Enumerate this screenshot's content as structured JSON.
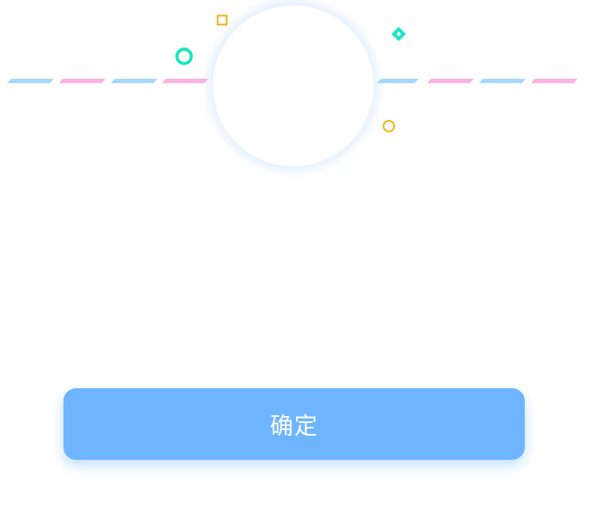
{
  "colors": {
    "blue_stripe": "#a6d8ff",
    "pink_stripe": "#ffb3e0",
    "teal": "#14e8c0",
    "yellow": "#f2b51d",
    "button": "#6fb4ff",
    "button_text": "#ffffff"
  },
  "decorations": {
    "icons": [
      "stripe-dash",
      "ring-icon",
      "square-outline-icon",
      "diamond-icon"
    ]
  },
  "confirm_button": {
    "label": "确定"
  }
}
